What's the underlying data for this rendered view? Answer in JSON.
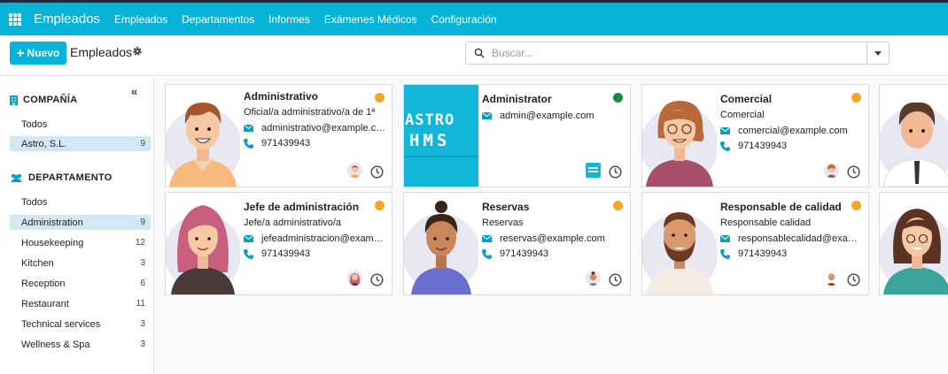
{
  "app": {
    "brand": "Empleados",
    "menu": [
      "Empleados",
      "Departamentos",
      "Informes",
      "Exámenes Médicos",
      "Configuración"
    ],
    "accent_color": "#07b3d6"
  },
  "control": {
    "new_label": "Nuevo",
    "view_title": "Empleados",
    "search_placeholder": "Buscar..."
  },
  "sidebar": {
    "company_header": "COMPAÑÍA",
    "company_items": [
      {
        "label": "Todos",
        "count": ""
      },
      {
        "label": "Astro, S.L.",
        "count": "9",
        "active": true
      }
    ],
    "department_header": "DEPARTAMENTO",
    "department_items": [
      {
        "label": "Todos",
        "count": ""
      },
      {
        "label": "Administration",
        "count": "9",
        "active": true
      },
      {
        "label": "Housekeeping",
        "count": "12"
      },
      {
        "label": "Kitchen",
        "count": "3"
      },
      {
        "label": "Reception",
        "count": "6"
      },
      {
        "label": "Restaurant",
        "count": "11"
      },
      {
        "label": "Technical services",
        "count": "3"
      },
      {
        "label": "Wellness & Spa",
        "count": "3"
      }
    ]
  },
  "employees": [
    {
      "name": "Administrativo",
      "job": "Oficial/a administrativo/a de 1ª",
      "email": "administrativo@example.com",
      "phone": "971439943",
      "status_color": "#f5a623",
      "photo": "man-orange-shirt-avatar"
    },
    {
      "name": "Administrator",
      "job": "",
      "email": "admin@example.com",
      "phone": "",
      "status_color": "#1e8a3d",
      "photo": "astro-hms-logo",
      "logo_line1": "ASTRO",
      "logo_line2": "HMS"
    },
    {
      "name": "Comercial",
      "job": "Comercial",
      "email": "comercial@example.com",
      "phone": "971439943",
      "status_color": "#f5a623",
      "photo": "woman-glasses-avatar"
    },
    {
      "name": "Jefe de administración",
      "job": "Jefe/a administrativo/a",
      "email": "jefeadministracion@example.com",
      "phone": "971439943",
      "status_color": "#f5a623",
      "photo": "woman-pink-hair-avatar"
    },
    {
      "name": "Reservas",
      "job": "Reservas",
      "email": "reservas@example.com",
      "phone": "971439943",
      "status_color": "#f5a623",
      "photo": "woman-bun-avatar"
    },
    {
      "name": "Responsable de calidad",
      "job": "Responsable calidad",
      "email": "responsablecalidad@example.com",
      "phone": "971439943",
      "status_color": "#f5a623",
      "photo": "man-beard-avatar"
    }
  ]
}
